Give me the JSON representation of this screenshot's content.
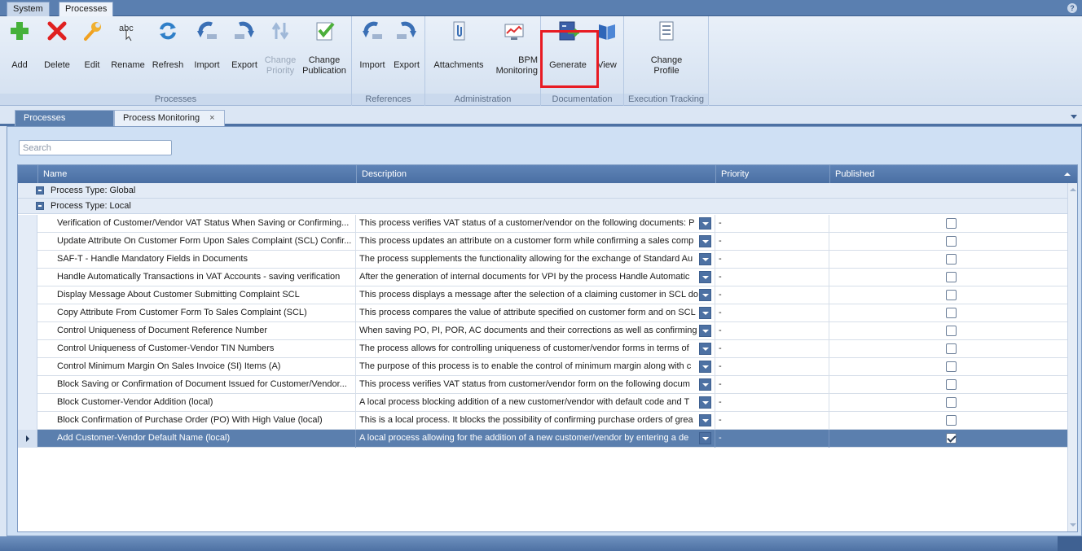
{
  "app_tabs": {
    "system": "System",
    "processes": "Processes"
  },
  "ribbon": {
    "groups": {
      "processes": "Processes",
      "references": "References",
      "administration": "Administration",
      "documentation": "Documentation",
      "execution_tracking": "Execution Tracking"
    },
    "buttons": {
      "add": "Add",
      "delete": "Delete",
      "edit": "Edit",
      "rename": "Rename",
      "refresh": "Refresh",
      "import": "Import",
      "export": "Export",
      "change_priority_1": "Change",
      "change_priority_2": "Priority",
      "change_publication_1": "Change",
      "change_publication_2": "Publication",
      "ref_import": "Import",
      "ref_export": "Export",
      "attachments": "Attachments",
      "bpm_1": "BPM",
      "bpm_2": "Monitoring",
      "generate": "Generate",
      "view": "View",
      "change_profile_1": "Change",
      "change_profile_2": "Profile"
    }
  },
  "doc_tabs": {
    "processes": "Processes",
    "monitoring": "Process Monitoring",
    "close": "×"
  },
  "search": {
    "placeholder": "Search"
  },
  "grid": {
    "columns": {
      "name": "Name",
      "description": "Description",
      "priority": "Priority",
      "published": "Published"
    },
    "group_global": "Process Type: Global",
    "group_local": "Process Type: Local",
    "rows": [
      {
        "name": "Verification of Customer/Vendor VAT Status When Saving or Confirming...",
        "description": "This process verifies VAT status of a customer/vendor on the following documents: P",
        "priority": "-",
        "published": false
      },
      {
        "name": "Update Attribute On Customer Form Upon Sales Complaint (SCL) Confir...",
        "description": "This process updates an attribute on a customer form while confirming a sales comp",
        "priority": "-",
        "published": false
      },
      {
        "name": "SAF-T - Handle Mandatory Fields in Documents",
        "description": "The process supplements the functionality allowing for the exchange of Standard Au",
        "priority": "-",
        "published": false
      },
      {
        "name": "Handle Automatically Transactions in VAT Accounts - saving verification",
        "description": "After the generation of internal documents for VPI by the process Handle Automatic",
        "priority": "-",
        "published": false
      },
      {
        "name": "Display Message About Customer Submitting Complaint SCL",
        "description": "This process displays a message after the selection of a claiming customer in SCL do",
        "priority": "-",
        "published": false
      },
      {
        "name": "Copy Attribute From Customer Form To Sales Complaint (SCL)",
        "description": "This process compares the value of attribute specified on customer form and on SCL",
        "priority": "-",
        "published": false
      },
      {
        "name": "Control Uniqueness of Document Reference Number",
        "description": "When saving PO, PI, POR, AC documents and their corrections as well as confirming",
        "priority": "-",
        "published": false
      },
      {
        "name": "Control Uniqueness of Customer-Vendor TIN Numbers",
        "description": "The process allows for controlling uniqueness of customer/vendor forms in terms of",
        "priority": "-",
        "published": false
      },
      {
        "name": "Control Minimum Margin On Sales Invoice (SI) Items (A)",
        "description": "The purpose of this process is to enable the control of minimum margin along with c",
        "priority": "-",
        "published": false
      },
      {
        "name": "Block Saving or Confirmation of Document Issued for Customer/Vendor...",
        "description": "This process verifies VAT status from customer/vendor form on the following docum",
        "priority": "-",
        "published": false
      },
      {
        "name": "Block Customer-Vendor Addition (local)",
        "description": "A local process blocking addition of a new customer/vendor with default code and T",
        "priority": "-",
        "published": false
      },
      {
        "name": "Block Confirmation of Purchase Order (PO) With High Value (local)",
        "description": "This is a local process. It blocks the possibility of confirming purchase orders of grea",
        "priority": "-",
        "published": false
      },
      {
        "name": "Add Customer-Vendor Default Name (local)",
        "description": "A local process allowing for the addition of a new customer/vendor by entering a de",
        "priority": "-",
        "published": true
      }
    ]
  },
  "colors": {
    "accent": "#4d71a3",
    "selected_row": "#5b7fae",
    "highlight": "#e81b23"
  }
}
